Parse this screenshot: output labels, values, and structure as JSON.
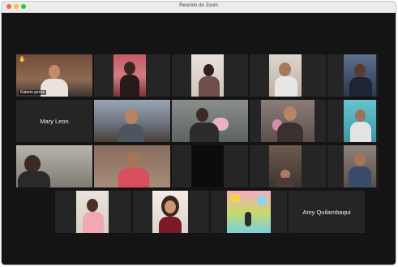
{
  "window": {
    "title": "Reunión de Zoom"
  },
  "gallery": {
    "kateryn_label": "Katerin perez",
    "mary_name": "Mary Leon",
    "amy_name": "Amy Quilambaqui"
  },
  "icons": {
    "raised_hand": "✋"
  }
}
